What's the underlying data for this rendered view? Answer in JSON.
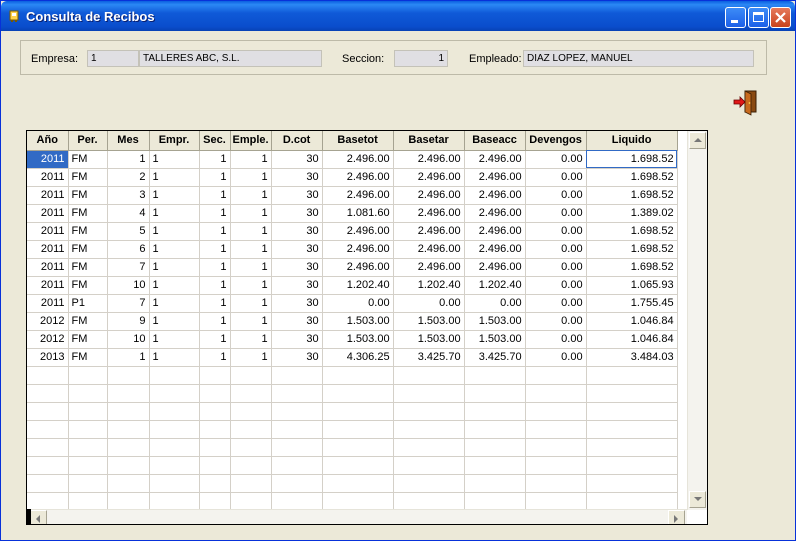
{
  "window": {
    "title": "Consulta de Recibos"
  },
  "info": {
    "empresa_label": "Empresa:",
    "empresa_code": "1",
    "empresa_name": "TALLERES ABC, S.L.",
    "seccion_label": "Seccion:",
    "seccion_value": "1",
    "empleado_label": "Empleado:",
    "empleado_value": "DIAZ  LOPEZ, MANUEL"
  },
  "grid": {
    "columns": [
      "Año",
      "Per.",
      "Mes",
      "Empr.",
      "Sec.",
      "Emple.",
      "D.cot",
      "Basetot",
      "Basetar",
      "Baseacc",
      "Devengos",
      "Liquido"
    ],
    "rows": [
      [
        "2011",
        "FM",
        "1",
        "1",
        "1",
        "1",
        "30",
        "2.496.00",
        "2.496.00",
        "2.496.00",
        "0.00",
        "1.698.52"
      ],
      [
        "2011",
        "FM",
        "2",
        "1",
        "1",
        "1",
        "30",
        "2.496.00",
        "2.496.00",
        "2.496.00",
        "0.00",
        "1.698.52"
      ],
      [
        "2011",
        "FM",
        "3",
        "1",
        "1",
        "1",
        "30",
        "2.496.00",
        "2.496.00",
        "2.496.00",
        "0.00",
        "1.698.52"
      ],
      [
        "2011",
        "FM",
        "4",
        "1",
        "1",
        "1",
        "30",
        "1.081.60",
        "2.496.00",
        "2.496.00",
        "0.00",
        "1.389.02"
      ],
      [
        "2011",
        "FM",
        "5",
        "1",
        "1",
        "1",
        "30",
        "2.496.00",
        "2.496.00",
        "2.496.00",
        "0.00",
        "1.698.52"
      ],
      [
        "2011",
        "FM",
        "6",
        "1",
        "1",
        "1",
        "30",
        "2.496.00",
        "2.496.00",
        "2.496.00",
        "0.00",
        "1.698.52"
      ],
      [
        "2011",
        "FM",
        "7",
        "1",
        "1",
        "1",
        "30",
        "2.496.00",
        "2.496.00",
        "2.496.00",
        "0.00",
        "1.698.52"
      ],
      [
        "2011",
        "FM",
        "10",
        "1",
        "1",
        "1",
        "30",
        "1.202.40",
        "1.202.40",
        "1.202.40",
        "0.00",
        "1.065.93"
      ],
      [
        "2011",
        "P1",
        "7",
        "1",
        "1",
        "1",
        "30",
        "0.00",
        "0.00",
        "0.00",
        "0.00",
        "1.755.45"
      ],
      [
        "2012",
        "FM",
        "9",
        "1",
        "1",
        "1",
        "30",
        "1.503.00",
        "1.503.00",
        "1.503.00",
        "0.00",
        "1.046.84"
      ],
      [
        "2012",
        "FM",
        "10",
        "1",
        "1",
        "1",
        "30",
        "1.503.00",
        "1.503.00",
        "1.503.00",
        "0.00",
        "1.046.84"
      ],
      [
        "2013",
        "FM",
        "1",
        "1",
        "1",
        "1",
        "30",
        "4.306.25",
        "3.425.70",
        "3.425.70",
        "0.00",
        "3.484.03"
      ]
    ],
    "empty_rows": 8,
    "selected_row": 0
  },
  "icons": {
    "title": "app-icon",
    "exit": "exit-door-icon",
    "minimize": "minimize-icon",
    "maximize": "maximize-icon",
    "close": "close-icon"
  },
  "colors": {
    "titlebar": "#0a4dcc",
    "selection": "#316ac5",
    "face": "#ece9d8",
    "field": "#e0dfe3"
  }
}
